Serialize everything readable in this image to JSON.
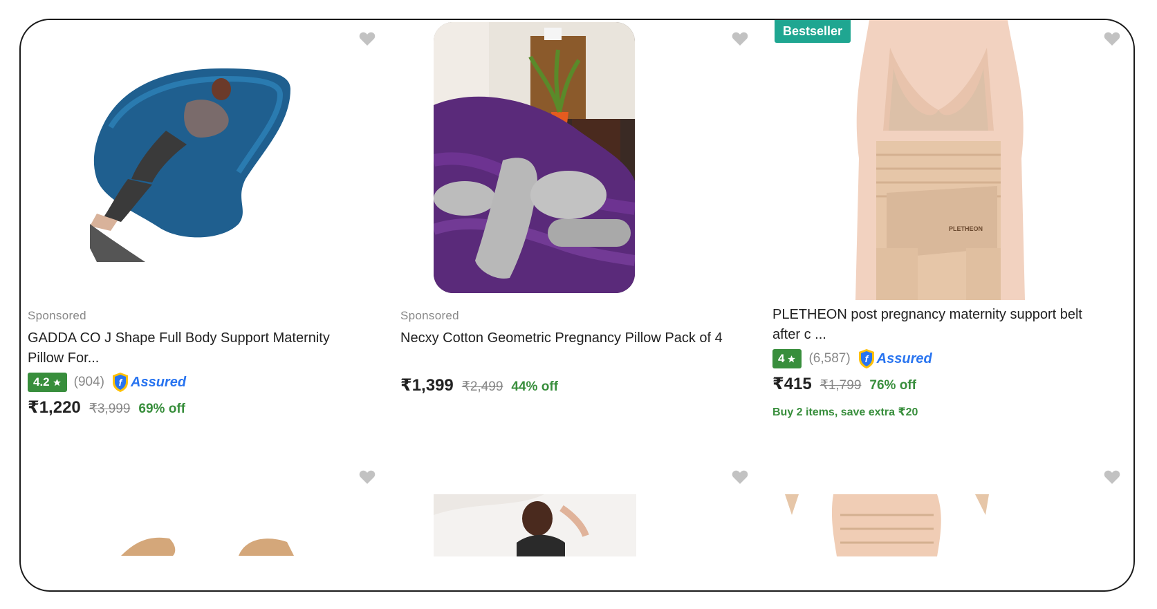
{
  "products": [
    {
      "sponsored": "Sponsored",
      "title": "GADDA CO J Shape Full Body Support Maternity Pillow For...",
      "rating": "4.2",
      "rating_count": "(904)",
      "assured": "Assured",
      "price": "₹1,220",
      "mrp": "₹3,999",
      "discount": "69% off"
    },
    {
      "sponsored": "Sponsored",
      "title": "Necxy Cotton Geometric Pregnancy Pillow Pack of 4",
      "price": "₹1,399",
      "mrp": "₹2,499",
      "discount": "44% off"
    },
    {
      "badge": "Bestseller",
      "title": "PLETHEON post pregnancy maternity support belt after c ...",
      "rating": "4",
      "rating_count": "(6,587)",
      "assured": "Assured",
      "price": "₹415",
      "mrp": "₹1,799",
      "discount": "76% off",
      "offer": "Buy 2 items, save extra ₹20",
      "belt_label": "PLETHEON"
    }
  ],
  "colors": {
    "rating_green": "#388e3c",
    "bestseller_teal": "#1fa691",
    "assured_blue": "#2874f0",
    "wishlist_gray": "#c2c2c2"
  },
  "icons": [
    "heart-icon",
    "star-icon",
    "assured-shield-icon"
  ]
}
